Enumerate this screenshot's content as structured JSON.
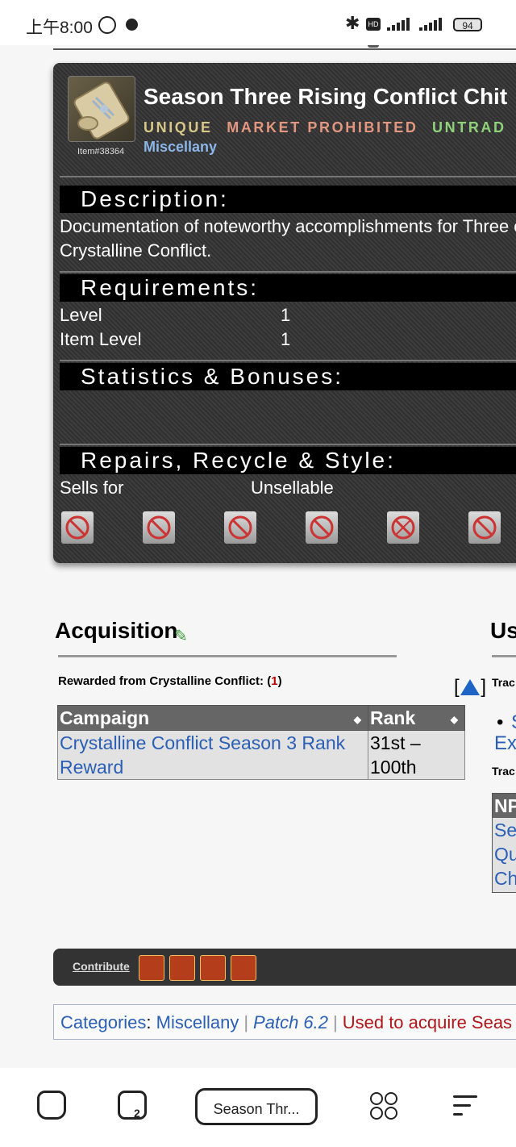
{
  "status_bar": {
    "time": "上午8:00",
    "hd": "HD",
    "battery": "94"
  },
  "item": {
    "name": "Season Three Rising Conflict Chit",
    "id_label": "Item#38364",
    "flags": [
      "UNIQUE",
      "MARKET PROHIBITED",
      "UNTRAD"
    ],
    "type": "Miscellany",
    "description_title": "Description:",
    "description": "Documentation of noteworthy accomplishments for Three of Crystalline Conflict.",
    "requirements_title": "Requirements:",
    "requirements": [
      {
        "label": "Level",
        "value": "1"
      },
      {
        "label": "Item Level",
        "value": "1"
      }
    ],
    "statistics_title": "Statistics & Bonuses:",
    "repairs_title": "Repairs, Recycle & Style:",
    "sells_for_label": "Sells for",
    "sells_for_value": "Unsellable"
  },
  "acquisition": {
    "title": "Acquisition",
    "rewarded_prefix": "Rewarded from Crystalline Conflict: (",
    "rewarded_count": "1",
    "rewarded_suffix": ")",
    "table": {
      "headers": [
        "Campaign",
        "Rank"
      ],
      "rows": [
        {
          "campaign": "Crystalline Conflict Season 3 Rank Reward",
          "rank": "31st – 100th"
        }
      ]
    }
  },
  "used": {
    "title_fragment": "Us",
    "trade_fragment_1": "Trac",
    "bullet_fragment": "S",
    "ex_fragment": "Ex",
    "trade_fragment_2": "Trac",
    "npc_header_fragment": "NP",
    "npc_rows": [
      "Sea",
      "Qu",
      "Ch"
    ]
  },
  "contribute": {
    "label": "Contribute"
  },
  "categories": {
    "label": "Categories",
    "items": [
      "Miscellany",
      "Patch 6.2",
      "Used to acquire Seas"
    ]
  },
  "browser": {
    "url_label": "Season Thr...",
    "tab_count": "2"
  }
}
